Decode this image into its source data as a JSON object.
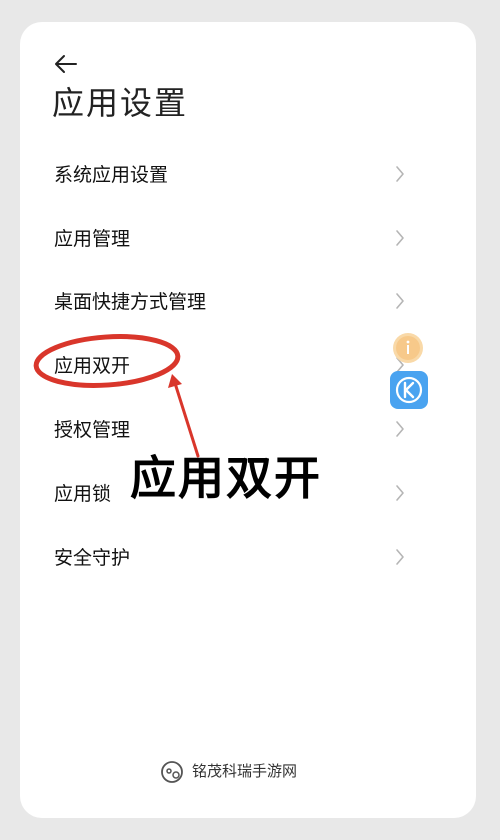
{
  "header": {
    "back_icon": "arrow-left-icon",
    "title": "应用设置"
  },
  "menu": {
    "items": [
      {
        "label": "系统应用设置"
      },
      {
        "label": "应用管理"
      },
      {
        "label": "桌面快捷方式管理"
      },
      {
        "label": "应用双开"
      },
      {
        "label": "授权管理"
      },
      {
        "label": "应用锁"
      },
      {
        "label": "安全守护"
      }
    ],
    "chevron_icon": "chevron-right-icon"
  },
  "annotation": {
    "text": "应用双开",
    "color": "#d9362b"
  },
  "floating_icons": [
    "info-badge-icon",
    "k-app-icon"
  ],
  "watermark": {
    "text": "铭茂科瑞手游网"
  }
}
